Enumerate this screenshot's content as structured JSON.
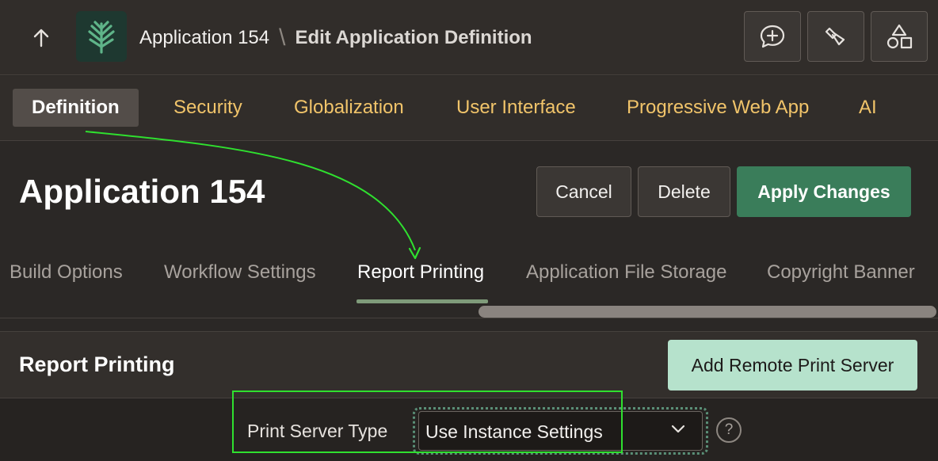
{
  "topbar": {
    "up_icon": "arrow-up-icon",
    "logo_icon": "fern-leaf-icon",
    "app_crumb": "Application 154",
    "separator": "\\",
    "page_crumb": "Edit Application Definition",
    "tools": [
      {
        "name": "feedback-icon"
      },
      {
        "name": "flashlight-icon"
      },
      {
        "name": "shapes-icon"
      }
    ]
  },
  "main_tabs": [
    {
      "label": "Definition",
      "active": true
    },
    {
      "label": "Security"
    },
    {
      "label": "Globalization"
    },
    {
      "label": "User Interface"
    },
    {
      "label": "Progressive Web App"
    },
    {
      "label": "AI"
    }
  ],
  "header": {
    "title": "Application 154",
    "cancel_label": "Cancel",
    "delete_label": "Delete",
    "apply_label": "Apply Changes"
  },
  "sub_tabs": [
    {
      "label": "Build Options"
    },
    {
      "label": "Workflow Settings"
    },
    {
      "label": "Report Printing",
      "active": true
    },
    {
      "label": "Application File Storage"
    },
    {
      "label": "Copyright Banner"
    }
  ],
  "region": {
    "title": "Report Printing",
    "add_server_label": "Add Remote Print Server",
    "field_label": "Print Server Type",
    "select_value": "Use Instance Settings",
    "help_glyph": "?"
  },
  "colors": {
    "accent_tab": "#f1c46a",
    "primary_button": "#3a7d5a",
    "soft_button": "#b6e2cc",
    "annotation": "#2fe02f"
  }
}
